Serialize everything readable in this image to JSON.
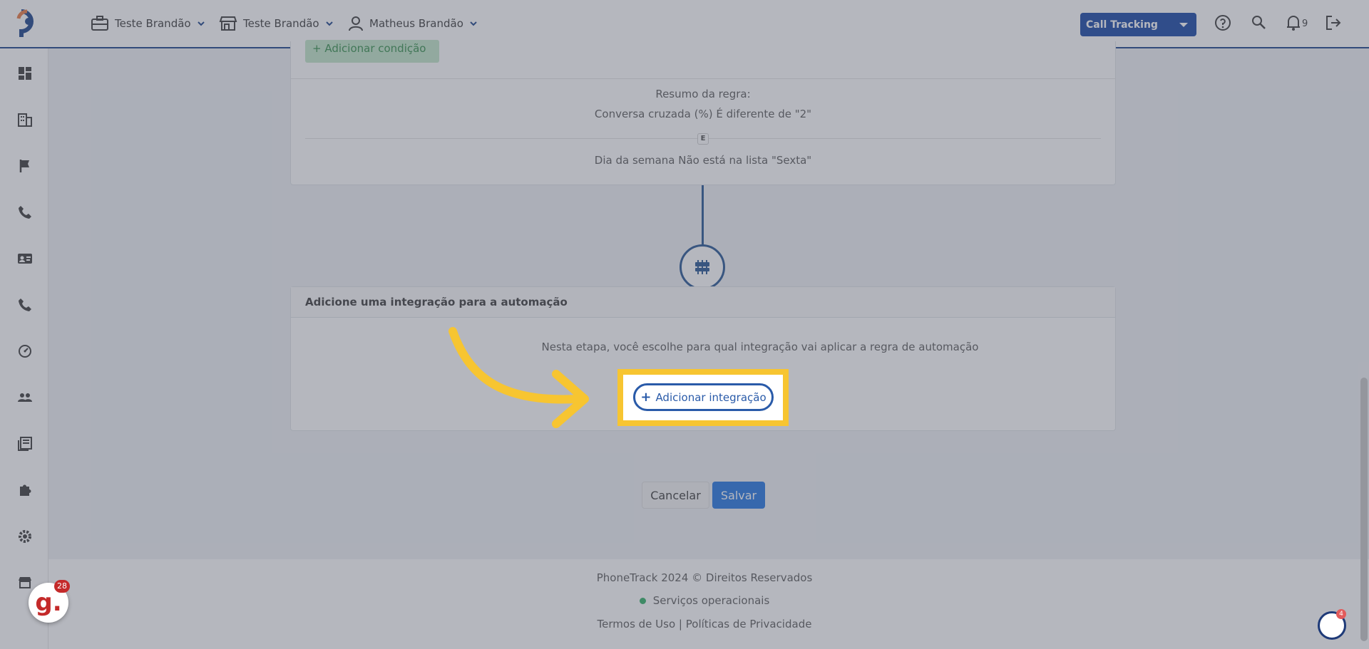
{
  "topbar": {
    "menus": [
      {
        "label": "Teste Brandão",
        "icon": "briefcase-icon"
      },
      {
        "label": "Teste Brandão",
        "icon": "store-icon"
      },
      {
        "label": "Matheus Brandão",
        "icon": "user-icon"
      }
    ],
    "product": "Call Tracking",
    "notifications": "9"
  },
  "sidebar": {
    "items": [
      "dashboard-icon",
      "building-icon",
      "flag-icon",
      "phone-icon",
      "contact-card-icon",
      "phone-icon",
      "speedometer-icon",
      "users-icon",
      "book-icon",
      "puzzle-icon",
      "gear-icon",
      "store-icon"
    ]
  },
  "rule": {
    "add_condition": "+ Adicionar condição",
    "summary_title": "Resumo da regra:",
    "condition_1": "Conversa cruzada (%) É diferente de \"2\"",
    "joiner": "E",
    "condition_2": "Dia da semana Não está na lista \"Sexta\""
  },
  "integration": {
    "title": "Adicione uma integração para a automação",
    "description": "Nesta etapa, você escolhe para qual integração vai aplicar a regra de automação",
    "button": "Adicionar integração"
  },
  "actions": {
    "cancel": "Cancelar",
    "save": "Salvar"
  },
  "footer": {
    "copyright": "PhoneTrack 2024 © Direitos Reservados",
    "status": "Serviços operacionais",
    "terms": "Termos de Uso",
    "separator": "|",
    "privacy": "Políticas de Privacidade"
  },
  "widgets": {
    "g_count": "28",
    "chat_count": "4"
  },
  "colors": {
    "brand_blue": "#0d3fa0",
    "save_blue": "#1a6fe0",
    "highlight_yellow": "#f7c531",
    "status_green": "#27ae60"
  }
}
